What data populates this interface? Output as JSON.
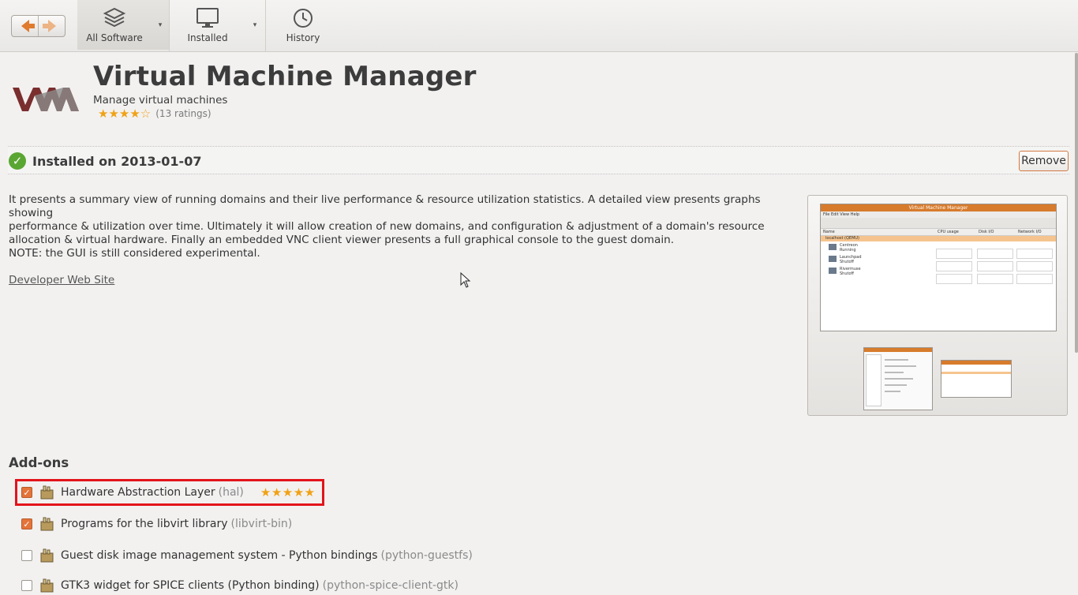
{
  "toolbar": {
    "all_software": "All Software",
    "installed": "Installed",
    "history": "History",
    "dropdown_glyph": "▾"
  },
  "app": {
    "title": "Virtual Machine Manager",
    "subtitle": "Manage virtual machines",
    "rating_stars": "★★★★☆",
    "rating_value": 4.5,
    "ratings_count": "(13 ratings)"
  },
  "install": {
    "status": "Installed on 2013-01-07",
    "remove_label": "Remove"
  },
  "description": {
    "body": "It presents a summary view of running domains and their live performance & resource utilization statistics. A detailed view presents graphs showing\nperformance & utilization over time. Ultimately it will allow creation of new domains, and configuration & adjustment of a domain's resource\nallocation & virtual hardware.  Finally an embedded VNC client viewer presents a full graphical console to the guest domain.",
    "note": "NOTE: the GUI is still considered experimental.",
    "developer_link": "Developer Web Site"
  },
  "screenshot": {
    "window_title": "Virtual Machine Manager",
    "menu": "File  Edit  View  Help",
    "columns": [
      "Name",
      "CPU usage",
      "Disk I/O",
      "Network I/O"
    ],
    "host": "localhost (QEMU)",
    "vms": [
      {
        "name": "Centreon",
        "state": "Running"
      },
      {
        "name": "Launchpad",
        "state": "Shutoff"
      },
      {
        "name": "Rivermuse",
        "state": "Shutoff"
      }
    ]
  },
  "addons": {
    "heading": "Add-ons",
    "items": [
      {
        "label": "Hardware Abstraction Layer",
        "pkg": "(hal)",
        "checked": true,
        "stars": "★★★★★"
      },
      {
        "label": "Programs for the libvirt library",
        "pkg": "(libvirt-bin)",
        "checked": true
      },
      {
        "label": "Guest disk image management system - Python bindings",
        "pkg": "(python-guestfs)",
        "checked": false
      },
      {
        "label": "GTK3 widget for SPICE clients (Python binding)",
        "pkg": "(python-spice-client-gtk)",
        "checked": false
      }
    ]
  },
  "colors": {
    "accent": "#e3743a",
    "highlight_box": "#e3141b",
    "star": "#f0a216",
    "check_green": "#5aa632"
  }
}
